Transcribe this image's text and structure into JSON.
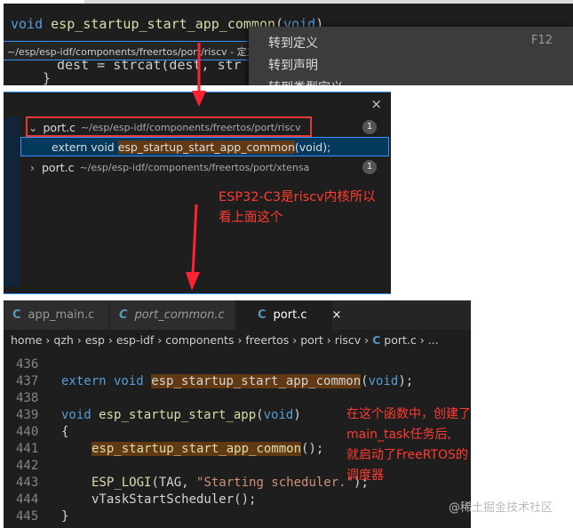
{
  "top": {
    "code": {
      "kw": "void",
      "fn": "esp_startup_start_app_common",
      "args_open": "(",
      "arg": "void",
      "args_close": ")"
    },
    "peek_path": "~/esp/esp-idf/components/freertos/port/riscv - 定义",
    "bg_line": "dest = strcat(dest, str",
    "bg_brace": "}",
    "menu": [
      {
        "label": "转到定义",
        "key": "F12"
      },
      {
        "label": "转到声明",
        "key": ""
      },
      {
        "label": "转到类型定义",
        "key": ""
      }
    ]
  },
  "refs": {
    "close": "×",
    "groups": [
      {
        "file": "port.c",
        "path": "~/esp/esp-idf/components/freertos/port/riscv",
        "count": "1",
        "expanded": true,
        "match": {
          "pre": "extern void ",
          "hl": "esp_startup_start_app_common",
          "post": "(void);"
        }
      },
      {
        "file": "port.c",
        "path": "~/esp/esp-idf/components/freertos/port/xtensa",
        "count": "1",
        "expanded": false
      }
    ],
    "annotation": [
      "ESP32-C3是riscv内核所以",
      "看上面这个"
    ]
  },
  "editor": {
    "tabs": [
      {
        "icon": "C",
        "label": "app_main.c"
      },
      {
        "icon": "C",
        "label": "port_common.c"
      },
      {
        "icon": "C",
        "label": "port.c",
        "close": "×"
      }
    ],
    "breadcrumb": "home › qzh › esp › esp-idf › components › freertos › port › riscv › ",
    "breadcrumb_file": "port.c",
    "breadcrumb_tail": " › ...",
    "lines": [
      "436",
      "437",
      "438",
      "439",
      "440",
      "441",
      "442",
      "443",
      "444",
      "445"
    ],
    "code": {
      "l437_kw": "extern void ",
      "l437_hl": "esp_startup_start_app_common",
      "l437_kw2": "void",
      "l439_kw": "void ",
      "l439_fn": "esp_startup_start_app",
      "l440": "{",
      "l441_hl": "esp_startup_start_app_common",
      "l441_post": "();",
      "l443_fn": "ESP_LOGI",
      "l443_a": "(TAG, ",
      "l443_str": "\"Starting scheduler.\"",
      "l443_end": ");",
      "l444": "vTaskStartScheduler();",
      "l445": "}"
    },
    "annotation": [
      "在这个函数中，创建了",
      "main_task任务后,",
      "就启动了FreeRTOS的调度器"
    ]
  },
  "watermark": "@稀土掘金技术社区"
}
